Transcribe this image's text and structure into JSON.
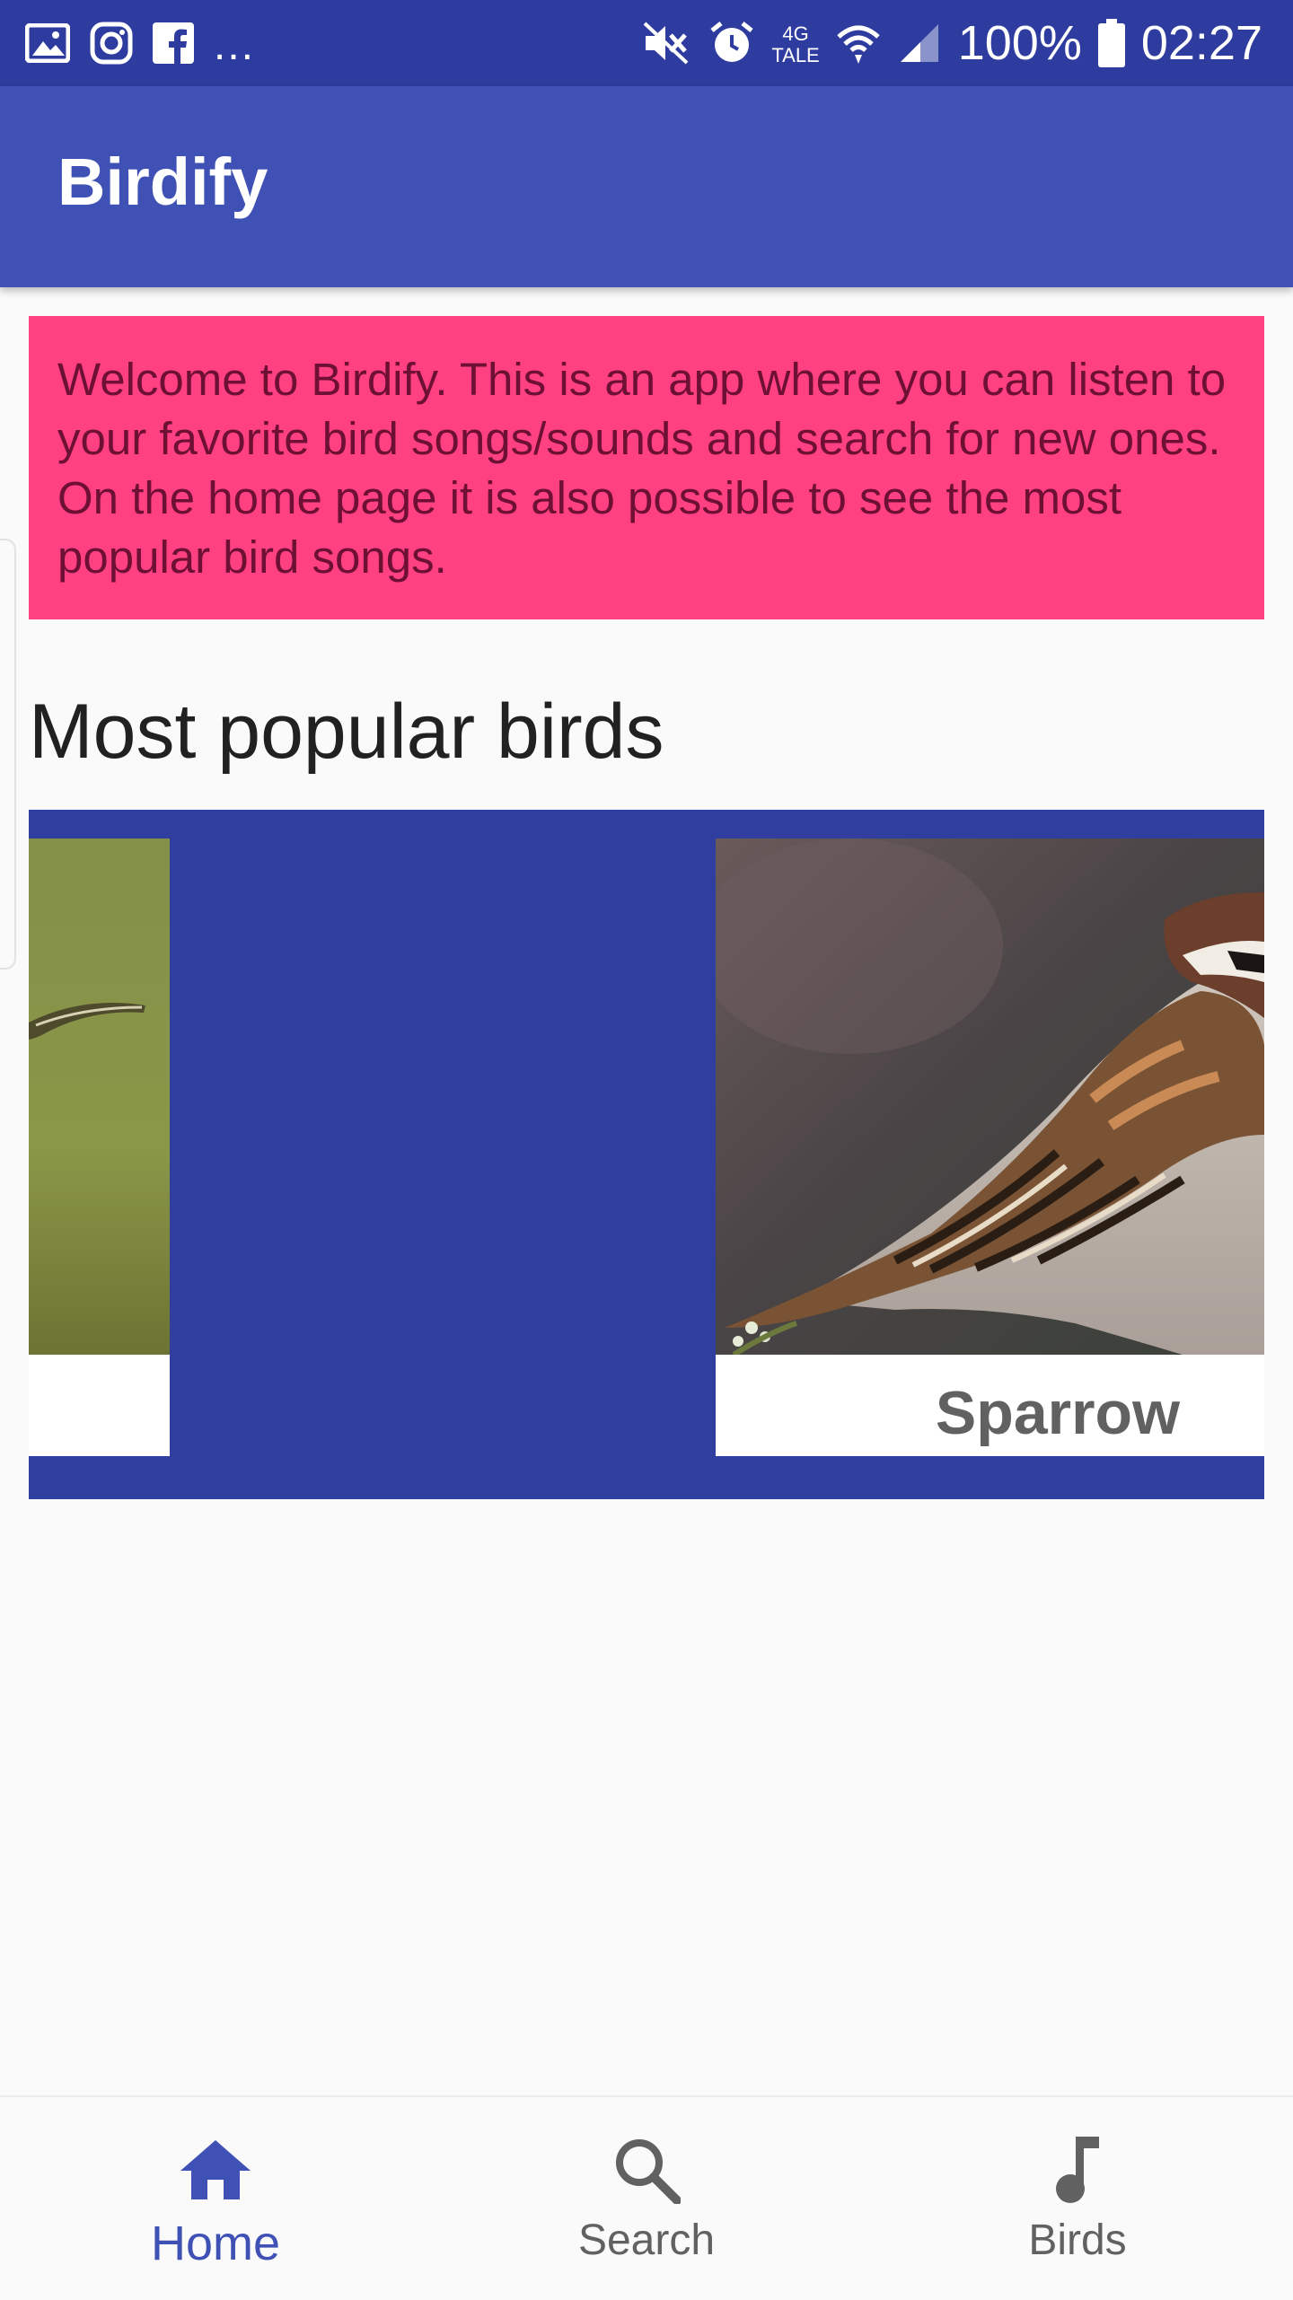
{
  "status_bar": {
    "network_top": "4G",
    "network_bottom": "TALE",
    "battery": "100%",
    "time": "02:27",
    "overflow": "...",
    "icons": [
      "gallery-icon",
      "instagram-icon",
      "facebook-icon",
      "mute-icon",
      "alarm-icon",
      "wifi-icon",
      "signal-icon",
      "battery-icon"
    ]
  },
  "app_bar": {
    "title": "Birdify"
  },
  "welcome": {
    "text": "Welcome to Birdify. This is an app where you can listen to your favorite bird songs/sounds and search for new ones. On the home page it is also possible to see the most popular bird songs."
  },
  "popular": {
    "title": "Most popular birds",
    "cards": [
      {
        "name": ""
      },
      {
        "name": "Sparrow"
      }
    ]
  },
  "bottom_nav": {
    "items": [
      {
        "label": "Home",
        "icon": "home-icon",
        "active": true
      },
      {
        "label": "Search",
        "icon": "search-icon",
        "active": false
      },
      {
        "label": "Birds",
        "icon": "music-note-icon",
        "active": false
      }
    ]
  },
  "colors": {
    "primary": "#3f51b5",
    "primary_dark": "#303f9f",
    "accent": "#ff4081",
    "background": "#fafafa"
  }
}
